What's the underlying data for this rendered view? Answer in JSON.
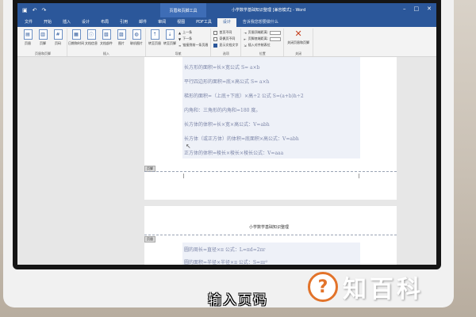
{
  "window": {
    "context_tools_label": "页眉和页脚工具",
    "document_title": "小学数学基础知识整理 [兼容模式] - Word"
  },
  "tabs": [
    {
      "label": "文件"
    },
    {
      "label": "开始"
    },
    {
      "label": "插入"
    },
    {
      "label": "设计"
    },
    {
      "label": "布局"
    },
    {
      "label": "引用"
    },
    {
      "label": "邮件"
    },
    {
      "label": "审阅"
    },
    {
      "label": "视图"
    },
    {
      "label": "PDF工具"
    },
    {
      "label": "设计"
    }
  ],
  "tell_me": "告诉我您想要做什么",
  "ribbon": {
    "groups": [
      {
        "name": "页眉和页脚",
        "buttons": [
          "页眉",
          "页脚",
          "页码"
        ]
      },
      {
        "name": "插入",
        "buttons": [
          "日期和时间",
          "文档信息",
          "文档部件",
          "图片",
          "联机图片"
        ]
      },
      {
        "name": "导航",
        "buttons": [
          "转至页眉",
          "转至页脚"
        ],
        "small": [
          "上一条",
          "下一条",
          "链接到前一条页眉"
        ]
      },
      {
        "name": "选项",
        "small": [
          "首页不同",
          "奇偶页不同",
          "显示文档文字"
        ]
      },
      {
        "name": "位置",
        "small": [
          "页眉顶端距离:",
          "页脚底端距离:",
          "插入对齐制表位"
        ]
      },
      {
        "name": "关闭",
        "buttons": [
          "关闭页眉和页脚"
        ]
      }
    ]
  },
  "document": {
    "page1_lines": [
      "长方形的面积=长×宽公式 S= a×b",
      "平行四边形的面积=底×高公式 S= a×h",
      "梯形的面积=（上底+下底）×高÷2 公式 S=(a+b)h÷2",
      "内角和：三角形的内角和=180 度。",
      "长方体的体积=长×宽×高公式：V=abh",
      "长方体（或正方体）的体积=底面积×高公式：V=abh",
      "正方体的体积=棱长×棱长×棱长公式：V=aaa"
    ],
    "footer_tag": "页脚",
    "page2_header": "小学数学基础知识整理",
    "header_tag": "页眉",
    "page2_lines": [
      "圆的周长=直径×π 公式：L=πd=2πr",
      "圆的面积=半径×半径×π 公式：S=πr²"
    ]
  },
  "caption": "输入页码",
  "watermark": {
    "symbol": "?",
    "text": "知百科"
  },
  "colors": {
    "accent": "#2b579a",
    "logo_orange": "#e2732a"
  }
}
